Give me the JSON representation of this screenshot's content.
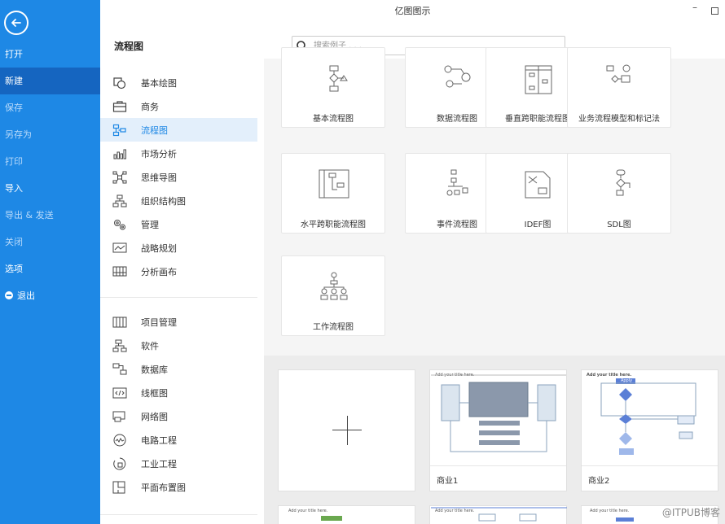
{
  "window": {
    "title": "亿图图示",
    "minimize": "–"
  },
  "nav": {
    "items": [
      {
        "label": "打开"
      },
      {
        "label": "新建"
      },
      {
        "label": "保存"
      },
      {
        "label": "另存为"
      },
      {
        "label": "打印"
      },
      {
        "label": "导入"
      },
      {
        "label": "导出 & 发送"
      },
      {
        "label": "关闭"
      },
      {
        "label": "选项"
      },
      {
        "label": "退出"
      }
    ]
  },
  "header": {
    "section_title": "流程图",
    "search_placeholder": "搜索例子 . . ."
  },
  "categories": {
    "group1": [
      {
        "label": "基本绘图",
        "icon": "shapes-icon"
      },
      {
        "label": "商务",
        "icon": "briefcase-icon"
      },
      {
        "label": "流程图",
        "icon": "flowchart-icon"
      },
      {
        "label": "市场分析",
        "icon": "bar-chart-icon"
      },
      {
        "label": "思维导图",
        "icon": "mindmap-icon"
      },
      {
        "label": "组织结构图",
        "icon": "orgchart-icon"
      },
      {
        "label": "管理",
        "icon": "gears-icon"
      },
      {
        "label": "战略规划",
        "icon": "trend-icon"
      },
      {
        "label": "分析画布",
        "icon": "canvas-icon"
      }
    ],
    "group2": [
      {
        "label": "项目管理",
        "icon": "gantt-icon"
      },
      {
        "label": "软件",
        "icon": "software-icon"
      },
      {
        "label": "数据库",
        "icon": "database-icon"
      },
      {
        "label": "线框图",
        "icon": "wireframe-icon"
      },
      {
        "label": "网络图",
        "icon": "network-icon"
      },
      {
        "label": "电路工程",
        "icon": "circuit-icon"
      },
      {
        "label": "工业工程",
        "icon": "industrial-icon"
      },
      {
        "label": "平面布置图",
        "icon": "floorplan-icon"
      }
    ]
  },
  "templates": [
    {
      "label": "基本流程图"
    },
    {
      "label": "数据流程图"
    },
    {
      "label": "垂直跨职能流程图"
    },
    {
      "label": "业务流程模型和标记法"
    },
    {
      "label": "水平跨职能流程图"
    },
    {
      "label": "事件流程图"
    },
    {
      "label": "IDEF图"
    },
    {
      "label": "SDL图"
    },
    {
      "label": "工作流程图"
    }
  ],
  "examples": [
    {
      "label": "商业1",
      "mini_title": "Add your title here."
    },
    {
      "label": "商业2",
      "mini_title": "Add your title here.",
      "mini_button": "Apply"
    },
    {
      "mini_title": "Add your title here."
    },
    {
      "mini_title": "Add your title here."
    },
    {
      "mini_title": "Add your title here."
    }
  ],
  "watermark": "@ITPUB博客",
  "colors": {
    "nav_bg": "#1e88e5",
    "nav_active": "#1565c0",
    "accent": "#1e88e5"
  }
}
